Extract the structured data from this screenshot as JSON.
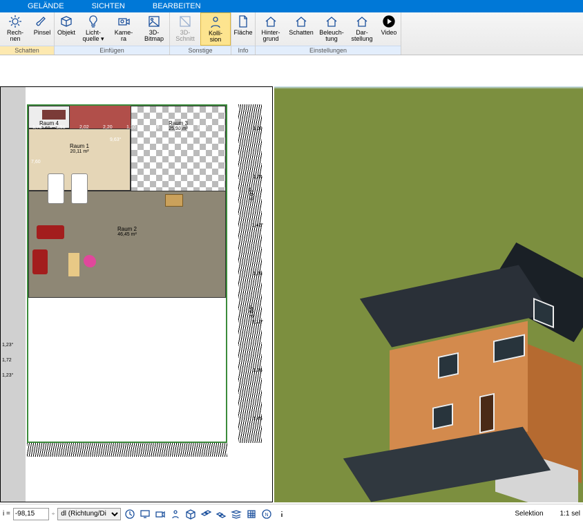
{
  "menu": {
    "items": [
      "GELÄNDE",
      "SICHTEN",
      "BEARBEITEN"
    ]
  },
  "ribbon": {
    "groups": [
      {
        "label": "Schatten",
        "buttons": [
          {
            "l1": "Rech-",
            "l2": "nen",
            "ic": "sun"
          },
          {
            "l1": "Pinsel",
            "l2": "",
            "ic": "brush"
          }
        ]
      },
      {
        "label": "Einfügen",
        "buttons": [
          {
            "l1": "Objekt",
            "l2": "",
            "ic": "cube"
          },
          {
            "l1": "Licht-",
            "l2": "quelle ▾",
            "ic": "bulb"
          },
          {
            "l1": "Kame-",
            "l2": "ra",
            "ic": "camera"
          },
          {
            "l1": "3D-",
            "l2": "Bitmap",
            "ic": "image"
          }
        ]
      },
      {
        "label": "Sonstige",
        "buttons": [
          {
            "l1": "3D-",
            "l2": "Schnitt",
            "ic": "cut",
            "dis": true
          },
          {
            "l1": "Kolli-",
            "l2": "sion",
            "ic": "person",
            "sel": true
          }
        ]
      },
      {
        "label": "Info",
        "buttons": [
          {
            "l1": "Fläche",
            "l2": "",
            "ic": "doc"
          }
        ]
      },
      {
        "label": "Einstellungen",
        "buttons": [
          {
            "l1": "Hinter-",
            "l2": "grund",
            "ic": "house"
          },
          {
            "l1": "Schatten",
            "l2": "",
            "ic": "house"
          },
          {
            "l1": "Beleuch-",
            "l2": "tung",
            "ic": "house"
          },
          {
            "l1": "Dar-",
            "l2": "stellung",
            "ic": "house"
          },
          {
            "l1": "Video",
            "l2": "",
            "ic": "play"
          }
        ]
      }
    ]
  },
  "plan": {
    "rooms": {
      "r1": {
        "name": "Raum 1",
        "area": "20,11 m²"
      },
      "r2": {
        "name": "Raum 2",
        "area": "46,45 m²"
      },
      "r3": {
        "name": "Raum 3",
        "area": "25,90 m²"
      },
      "r4": {
        "name": "Raum 4",
        "area": "2,69 m²"
      }
    },
    "dims_left": [
      "1,23°",
      "1,72",
      "1,23°"
    ],
    "dims_terr": [
      "1,78",
      "1,51",
      "2,02",
      "2,20",
      "1,10",
      "1,76",
      "1,76",
      "1,35°",
      "9,63°",
      "7,60"
    ],
    "dims_right": [
      "1,09",
      "1,76",
      "1,42°",
      "1,78",
      "2,12°",
      "1,76",
      "1,45"
    ],
    "dims_right_outer": [
      "6,97°",
      "3,84°"
    ]
  },
  "status": {
    "i_label": "i =",
    "i_value": "-98,15",
    "spin": "÷",
    "dropdown": "dl (Richtung/Di",
    "right1": "Selektion",
    "right2": "1:1 sel"
  }
}
